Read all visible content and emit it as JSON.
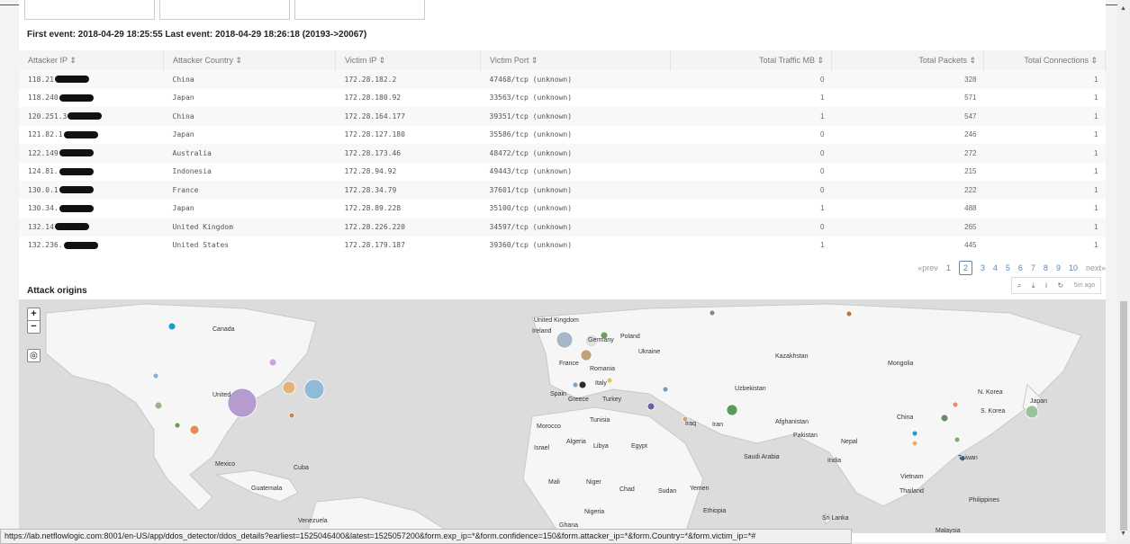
{
  "events_text": "First event: 2018-04-29 18:25:55 Last event: 2018-04-29 18:26:18 (20193->20067)",
  "table": {
    "headers": [
      "Attacker IP ⇕",
      "Attacker Country ⇕",
      "Victim IP ⇕",
      "Victim Port ⇕",
      "Total Traffic MB ⇕",
      "Total Packets ⇕",
      "Total Connections ⇕"
    ],
    "rows": [
      {
        "ip": "118.21",
        "country": "China",
        "victim_ip": "172.28.182.2",
        "port": "47468/tcp (unknown)",
        "mb": "0",
        "packets": "328",
        "conns": "1"
      },
      {
        "ip": "118.240",
        "country": "Japan",
        "victim_ip": "172.28.180.92",
        "port": "33563/tcp (unknown)",
        "mb": "1",
        "packets": "571",
        "conns": "1"
      },
      {
        "ip": "120.251.3",
        "country": "China",
        "victim_ip": "172.28.164.177",
        "port": "39351/tcp (unknown)",
        "mb": "1",
        "packets": "547",
        "conns": "1"
      },
      {
        "ip": "121.82.1",
        "country": "Japan",
        "victim_ip": "172.28.127.180",
        "port": "35586/tcp (unknown)",
        "mb": "0",
        "packets": "246",
        "conns": "1"
      },
      {
        "ip": "122.149",
        "country": "Australia",
        "victim_ip": "172.28.173.46",
        "port": "48472/tcp (unknown)",
        "mb": "0",
        "packets": "272",
        "conns": "1"
      },
      {
        "ip": "124.81.",
        "country": "Indonesia",
        "victim_ip": "172.28.94.92",
        "port": "49443/tcp (unknown)",
        "mb": "0",
        "packets": "215",
        "conns": "1"
      },
      {
        "ip": "130.0.1",
        "country": "France",
        "victim_ip": "172.28.34.79",
        "port": "37601/tcp (unknown)",
        "mb": "0",
        "packets": "222",
        "conns": "1"
      },
      {
        "ip": "130.34.",
        "country": "Japan",
        "victim_ip": "172.28.89.228",
        "port": "35100/tcp (unknown)",
        "mb": "1",
        "packets": "488",
        "conns": "1"
      },
      {
        "ip": "132.14",
        "country": "United Kingdom",
        "victim_ip": "172.28.226.220",
        "port": "34597/tcp (unknown)",
        "mb": "0",
        "packets": "265",
        "conns": "1"
      },
      {
        "ip": "132.236.",
        "country": "United States",
        "victim_ip": "172.28.179.187",
        "port": "39360/tcp (unknown)",
        "mb": "1",
        "packets": "445",
        "conns": "1"
      }
    ]
  },
  "pager": {
    "prev": "«prev",
    "pages": [
      "1",
      "2",
      "3",
      "4",
      "5",
      "6",
      "7",
      "8",
      "9",
      "10"
    ],
    "current": "2",
    "next": "next»"
  },
  "toolbar": {
    "search": "⌕",
    "export": "⤓",
    "inspect": "i",
    "refresh": "↻",
    "ago": "5m ago"
  },
  "section_title": "Attack origins",
  "map": {
    "zoom_in": "+",
    "zoom_out": "−",
    "locate": "◎",
    "labels": [
      "Canada",
      "United Kingdom",
      "Ireland",
      "Germany",
      "Poland",
      "Ukraine",
      "Kazakhstan",
      "Mongolia",
      "France",
      "Romania",
      "Italy",
      "Spain",
      "Greece",
      "Turkey",
      "Uzbekistan",
      "N. Korea",
      "Japan",
      "S. Korea",
      "China",
      "United",
      "Tunisia",
      "Morocco",
      "Iraq",
      "Iran",
      "Afghanistan",
      "Pakistan",
      "Israel",
      "Algeria",
      "Libya",
      "Egypt",
      "Saudi Arabia",
      "Nepal",
      "India",
      "Taiwan",
      "Mexico",
      "Cuba",
      "Guatemala",
      "Mali",
      "Niger",
      "Chad",
      "Sudan",
      "Yemen",
      "Vietnam",
      "Thailand",
      "Philippines",
      "Venezuela",
      "Ghana",
      "Nigeria",
      "Cameroon",
      "Ethiopia",
      "Sri Lanka",
      "Malaysia"
    ]
  },
  "status_url": "https://lab.netflowlogic.com:8001/en-US/app/ddos_detector/ddos_details?earliest=1525046400&latest=1525057200&form.exp_ip=*&form.confidence=150&form.attacker_ip=*&form.Country=*&form.victim_ip=*#"
}
